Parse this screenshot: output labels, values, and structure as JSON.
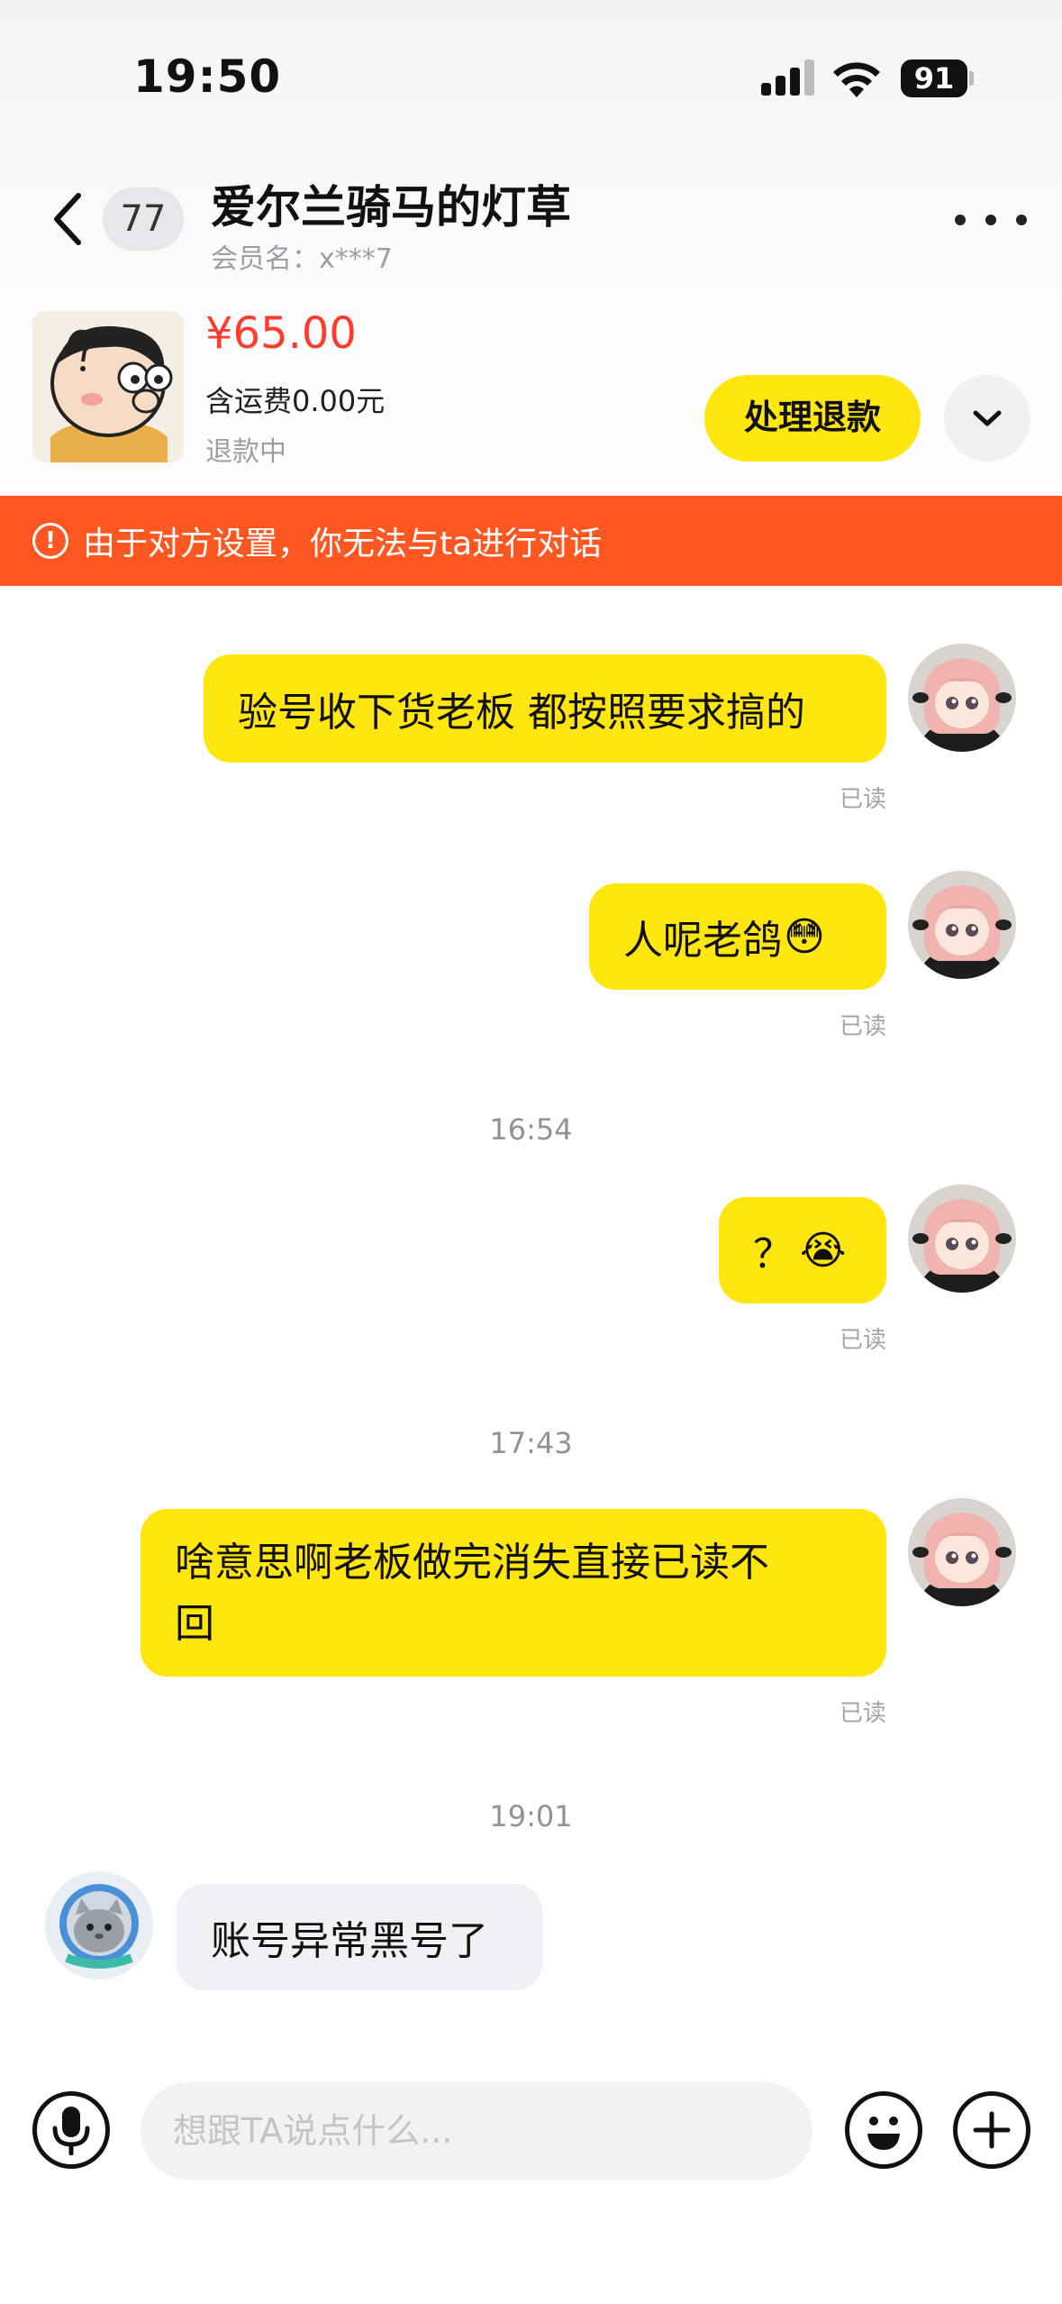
{
  "status_bar": {
    "time": "19:50",
    "battery": "91",
    "icons": [
      "signal-icon",
      "wifi-icon",
      "battery-icon"
    ]
  },
  "header": {
    "back_icon": "chevron-left-icon",
    "unread_count": "77",
    "title": "爱尔兰骑马的灯草",
    "member_label": "会员名：x***7",
    "more_icon": "more-dots-icon"
  },
  "product": {
    "price": "¥65.00",
    "shipping": "含运费0.00元",
    "status": "退款中",
    "refund_button": "处理退款",
    "expand_icon": "chevron-down-icon"
  },
  "banner": {
    "icon": "alert-circle-icon",
    "text": "由于对方设置，你无法与ta进行对话"
  },
  "messages": [
    {
      "sender": "me",
      "text": "验号收下货老板 都按照要求搞的",
      "status": "已读"
    },
    {
      "sender": "me",
      "text": "人呢老鸽",
      "emoji": "😳",
      "status": "已读"
    },
    {
      "type": "time",
      "text": "16:54"
    },
    {
      "sender": "me",
      "text": "？",
      "emoji": "😭",
      "status": "已读"
    },
    {
      "type": "time",
      "text": "17:43"
    },
    {
      "sender": "me",
      "text_line1": "啥意思啊老板做完消失直接已读不",
      "text_line2": "回",
      "status": "已读"
    },
    {
      "type": "time",
      "text": "19:01"
    },
    {
      "sender": "other",
      "text": "账号异常黑号了"
    }
  ],
  "input_bar": {
    "placeholder": "想跟TA说点什么...",
    "icons": [
      "microphone-icon",
      "emoji-icon",
      "plus-icon"
    ]
  },
  "colors": {
    "accent_yellow": "#ffe60f",
    "banner_orange": "#ff5722",
    "price_red": "#ff3b30"
  }
}
